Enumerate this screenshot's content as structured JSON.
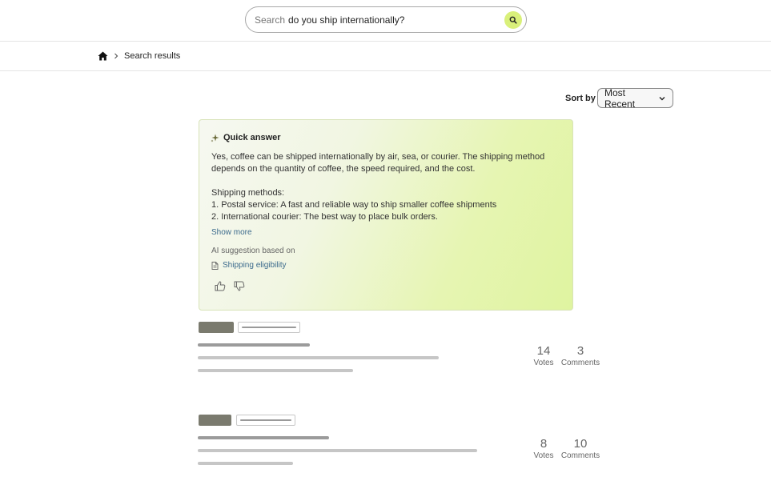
{
  "search": {
    "label": "Search",
    "value": "do you ship internationally?"
  },
  "breadcrumb": {
    "current": "Search results"
  },
  "sort": {
    "label": "Sort by",
    "selected": "Most Recent"
  },
  "quick_answer": {
    "title": "Quick answer",
    "text": "Yes, coffee can be shipped internationally by air, sea, or courier. The shipping method depends on the quantity of coffee, the speed required, and the cost.",
    "methods_heading": "Shipping methods:",
    "methods": [
      "1.  Postal service: A fast and reliable way to ship smaller coffee shipments",
      "2. International courier: The best way to place bulk orders."
    ],
    "show_more": "Show more",
    "based_on": "AI suggestion based on",
    "source": "Shipping eligibility"
  },
  "results": [
    {
      "votes": "14",
      "votes_label": "Votes",
      "comments": "3",
      "comments_label": "Comments"
    },
    {
      "votes": "8",
      "votes_label": "Votes",
      "comments": "10",
      "comments_label": "Comments"
    }
  ],
  "colors": {
    "search_button": "#d9f07a",
    "link": "#3b6a8c",
    "tag_dark": "#7a7a6e"
  }
}
